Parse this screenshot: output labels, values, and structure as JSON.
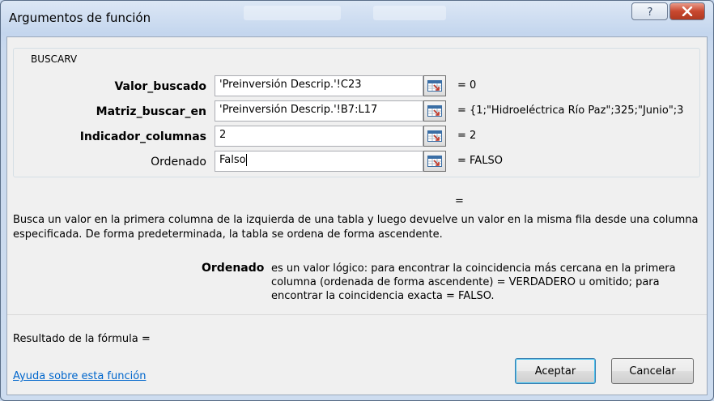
{
  "window": {
    "title": "Argumentos de función"
  },
  "function_group": {
    "name": "BUSCARV"
  },
  "arguments": [
    {
      "label": "Valor_buscado",
      "value": "'Preinversión Descrip.'!C23",
      "result": "=  0",
      "bold": true
    },
    {
      "label": "Matriz_buscar_en",
      "value": "'Preinversión Descrip.'!B7:L17",
      "result": "=  {1;\"Hidroeléctrica Río Paz\";325;\"Junio\";3",
      "bold": true
    },
    {
      "label": "Indicador_columnas",
      "value": "2",
      "result": "=  2",
      "bold": true
    },
    {
      "label": "Ordenado",
      "value": "Falso",
      "result": "=  FALSO",
      "bold": false
    }
  ],
  "overall_equals": "=",
  "description": "Busca un valor en la primera columna de la izquierda de una tabla y luego devuelve un valor en la misma fila desde una columna especificada. De forma predeterminada, la tabla se ordena de forma ascendente.",
  "arg_help": {
    "name": "Ordenado",
    "text": "es un valor lógico: para encontrar la coincidencia más cercana en la primera columna (ordenada de forma ascendente) = VERDADERO u omitido; para encontrar la coincidencia exacta = FALSO."
  },
  "formula_result": {
    "label": "Resultado de la fórmula ="
  },
  "help_link": "Ayuda sobre esta función",
  "buttons": {
    "accept": "Aceptar",
    "cancel": "Cancelar"
  },
  "icons": {
    "help": "question-icon",
    "close": "close-icon",
    "ref": "range-collapse-icon"
  },
  "colors": {
    "title_bg": "#c9d9ee",
    "close_bg": "#c8482f",
    "link": "#0066cc"
  }
}
